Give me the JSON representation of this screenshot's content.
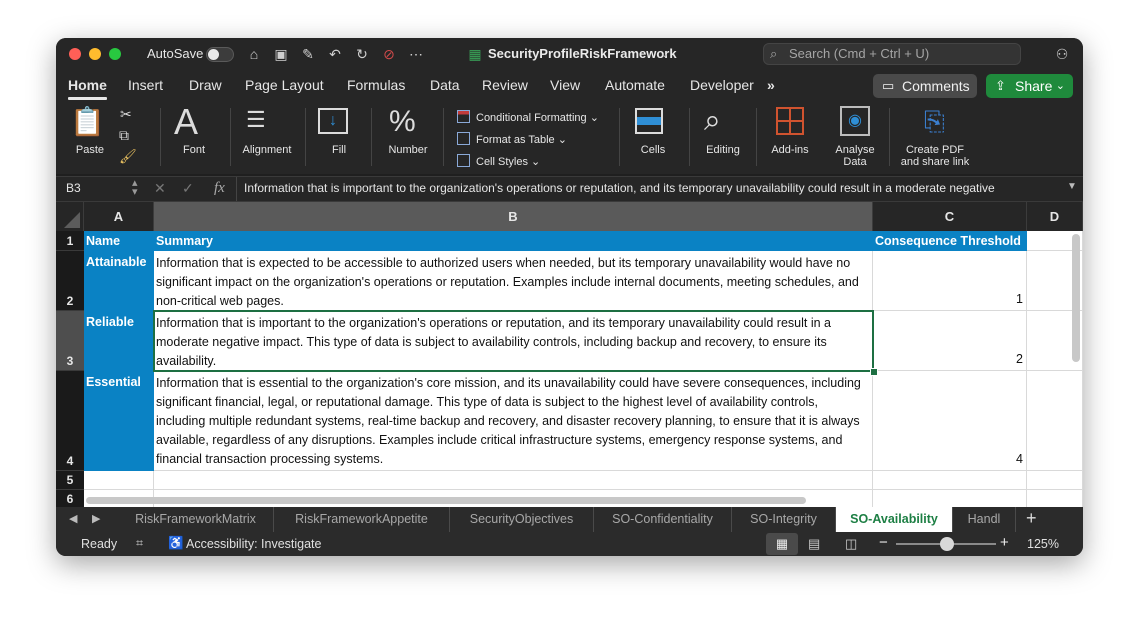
{
  "window": {
    "autosave_label": "AutoSave",
    "doc_title": "SecurityProfileRiskFramework",
    "search_placeholder": "Search (Cmd + Ctrl + U)"
  },
  "menu_tabs": [
    "Home",
    "Insert",
    "Draw",
    "Page Layout",
    "Formulas",
    "Data",
    "Review",
    "View",
    "Automate",
    "Developer"
  ],
  "menu_more": "»",
  "comments_label": "Comments",
  "share_label": "Share",
  "ribbon": {
    "paste": "Paste",
    "font": "Font",
    "alignment": "Alignment",
    "fill": "Fill",
    "number": "Number",
    "conditional_formatting": "Conditional Formatting",
    "format_as_table": "Format as Table",
    "cell_styles": "Cell Styles",
    "cells": "Cells",
    "editing": "Editing",
    "addins": "Add-ins",
    "analyse_data_1": "Analyse",
    "analyse_data_2": "Data",
    "create_pdf_1": "Create PDF",
    "create_pdf_2": "and share link"
  },
  "formula_bar": {
    "name_box": "B3",
    "fx": "fx",
    "content": "Information that is important to the organization's operations or reputation, and its temporary unavailability could result in a moderate negative"
  },
  "columns": [
    "A",
    "B",
    "C",
    "D"
  ],
  "row_numbers": [
    "1",
    "2",
    "3",
    "4",
    "5",
    "6"
  ],
  "header_row": {
    "name": "Name",
    "summary": "Summary",
    "threshold": "Consequence Threshold"
  },
  "rows": [
    {
      "name": "Attainable",
      "summary": "Information that is expected to be accessible to authorized users when needed, but its temporary unavailability would have no significant impact on the organization's operations or reputation. Examples include internal documents, meeting schedules, and non-critical web pages.",
      "threshold": "1"
    },
    {
      "name": "Reliable",
      "summary": "Information that is important to the organization's operations or reputation, and its temporary unavailability could result in a moderate negative impact. This type of data is subject to availability controls, including backup and recovery, to ensure its availability.",
      "threshold": "2"
    },
    {
      "name": "Essential",
      "summary": "Information that is essential to the organization's core mission, and its unavailability could have severe consequences, including significant financial, legal, or reputational damage. This type of data is subject to the highest level of availability controls, including multiple redundant systems, real-time backup and recovery, and disaster recovery planning, to ensure that it is always available, regardless of any disruptions. Examples include critical infrastructure systems, emergency response systems, and financial transaction processing systems.",
      "threshold": "4"
    }
  ],
  "sheet_tabs": [
    "RiskFrameworkMatrix",
    "RiskFrameworkAppetite",
    "SecurityObjectives",
    "SO-Confidentiality",
    "SO-Integrity",
    "SO-Availability",
    "Handl"
  ],
  "active_sheet": "SO-Availability",
  "status": {
    "ready": "Ready",
    "accessibility": "Accessibility: Investigate",
    "zoom": "125%"
  }
}
